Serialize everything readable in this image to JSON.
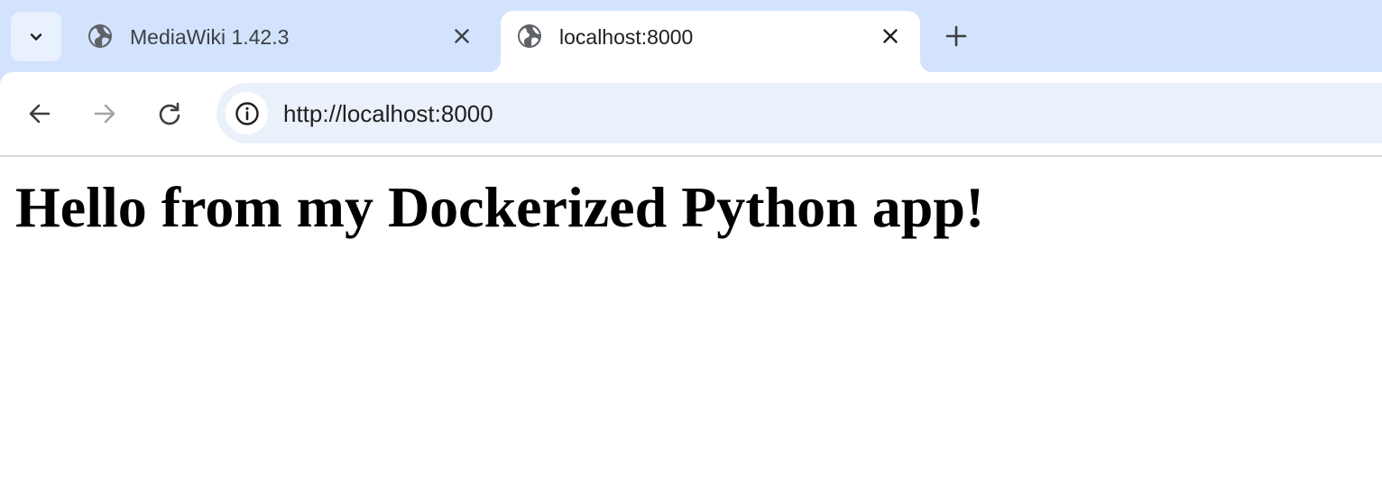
{
  "tabs": [
    {
      "title": "MediaWiki 1.42.3",
      "icon": "globe-icon",
      "active": false
    },
    {
      "title": "localhost:8000",
      "icon": "globe-icon",
      "active": true
    }
  ],
  "address_bar": {
    "url": "http://localhost:8000"
  },
  "page": {
    "heading": "Hello from my Dockerized Python app!"
  },
  "colors": {
    "tabstrip": "#d3e3fd",
    "omnibox": "#ebf1fa"
  }
}
